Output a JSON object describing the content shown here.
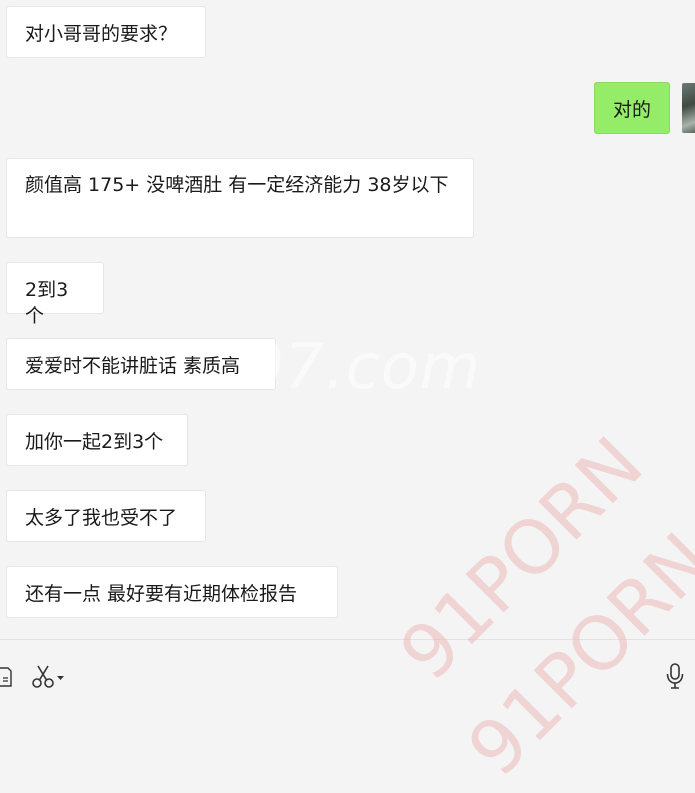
{
  "messages": [
    {
      "side": "in",
      "text": "对小哥哥的要求？"
    },
    {
      "side": "out",
      "text": "对的"
    },
    {
      "side": "in",
      "text": "颜值高 175+ 没啤酒肚 有一定经济能力 38岁以下"
    },
    {
      "side": "in",
      "text": "2到3个"
    },
    {
      "side": "in",
      "text": "爱爱时不能讲脏话 素质高"
    },
    {
      "side": "in",
      "text": "加你一起2到3个"
    },
    {
      "side": "in",
      "text": "太多了我也受不了"
    },
    {
      "side": "in",
      "text": "还有一点 最好要有近期体检报告"
    }
  ],
  "watermarks": {
    "url": "...07.com",
    "porn_1": "91PORN",
    "porn_2": "91PORN"
  },
  "toolbar": {
    "icons": [
      "file-icon",
      "scissors-icon",
      "microphone-icon"
    ]
  },
  "colors": {
    "background": "#f4f4f4",
    "incoming_bubble": "#ffffff",
    "outgoing_bubble": "#95ec69"
  }
}
